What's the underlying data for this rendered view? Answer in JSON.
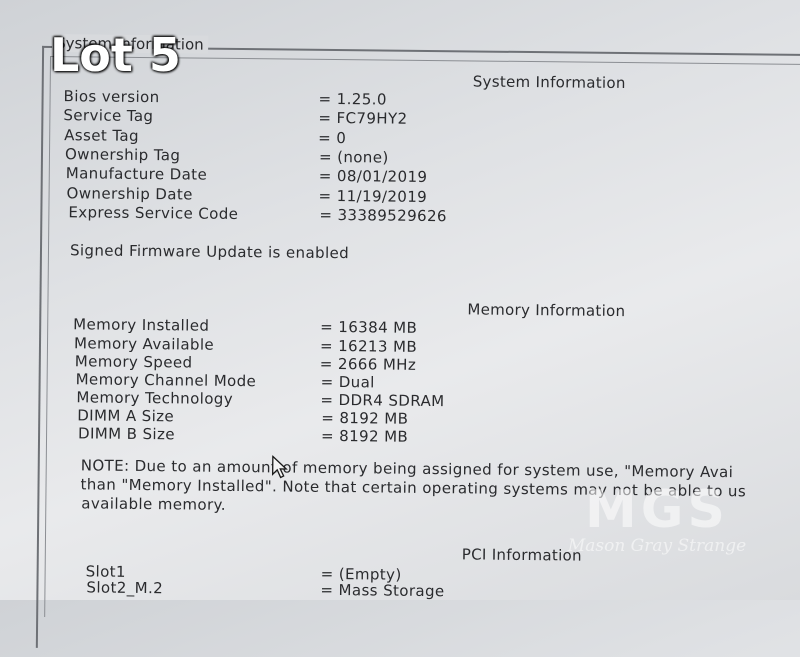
{
  "frame": {
    "legend": "System Information"
  },
  "system": {
    "title": "System Information",
    "rows": [
      {
        "label": "Bios version",
        "value": "= 1.25.0"
      },
      {
        "label": "Service Tag",
        "value": "= FC79HY2"
      },
      {
        "label": "Asset Tag",
        "value": "= 0"
      },
      {
        "label": "Ownership Tag",
        "value": "= (none)"
      },
      {
        "label": "Manufacture Date",
        "value": "= 08/01/2019"
      },
      {
        "label": "Ownership Date",
        "value": "= 11/19/2019"
      },
      {
        "label": "Express Service Code",
        "value": "= 33389529626"
      }
    ],
    "firmware_note": "Signed Firmware Update is enabled"
  },
  "memory": {
    "title": "Memory Information",
    "rows": [
      {
        "label": "Memory Installed",
        "value": "= 16384 MB"
      },
      {
        "label": "Memory Available",
        "value": "= 16213 MB"
      },
      {
        "label": "Memory Speed",
        "value": "= 2666 MHz"
      },
      {
        "label": "Memory Channel Mode",
        "value": "= Dual"
      },
      {
        "label": "Memory Technology",
        "value": "= DDR4 SDRAM"
      },
      {
        "label": "DIMM A Size",
        "value": "= 8192 MB"
      },
      {
        "label": "DIMM B Size",
        "value": "= 8192 MB"
      }
    ],
    "note_lines": [
      "NOTE: Due to an amount of memory being assigned for system use, \"Memory Avai",
      "than \"Memory Installed\". Note that certain operating systems may not be able to us",
      "available memory."
    ]
  },
  "pci": {
    "title": "PCI Information",
    "rows": [
      {
        "label": "Slot1",
        "value": "= (Empty)"
      },
      {
        "label": "Slot2_M.2",
        "value": "= Mass Storage"
      }
    ]
  },
  "overlay": {
    "lot_label": "Lot 5"
  },
  "watermark": {
    "logo": "MGS",
    "subtitle": "Mason Gray Strange"
  },
  "icons": {
    "cursor": "mouse-pointer-icon"
  }
}
